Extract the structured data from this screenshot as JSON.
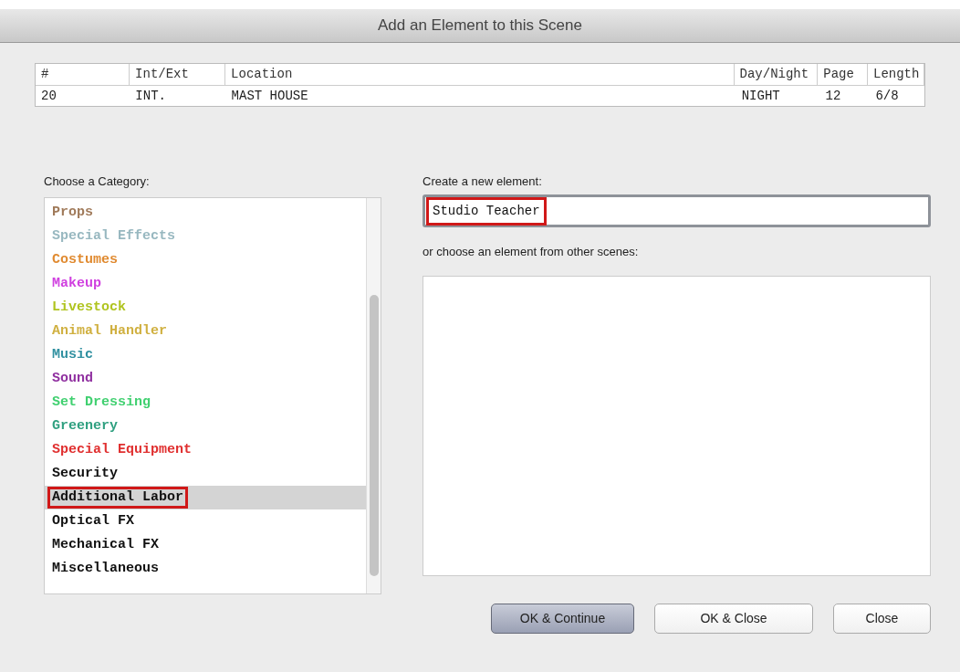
{
  "window": {
    "title": "Add an Element to this Scene"
  },
  "scene_table": {
    "columns": [
      "#",
      "Int/Ext",
      "Location",
      "Day/Night",
      "Page",
      "Length"
    ],
    "rows": [
      [
        "20",
        "INT.",
        "MAST HOUSE",
        "NIGHT",
        "12",
        "6/8"
      ]
    ]
  },
  "category_label": "Choose a Category:",
  "categories": [
    {
      "label": "Props",
      "color": "#a07a5a",
      "selected": false,
      "annotated": false
    },
    {
      "label": "Special Effects",
      "color": "#98b8c0",
      "selected": false,
      "annotated": false
    },
    {
      "label": "Costumes",
      "color": "#e08a30",
      "selected": false,
      "annotated": false
    },
    {
      "label": "Makeup",
      "color": "#d040e0",
      "selected": false,
      "annotated": false
    },
    {
      "label": "Livestock",
      "color": "#b0c420",
      "selected": false,
      "annotated": false
    },
    {
      "label": "Animal Handler",
      "color": "#d0b040",
      "selected": false,
      "annotated": false
    },
    {
      "label": "Music",
      "color": "#3090a0",
      "selected": false,
      "annotated": false
    },
    {
      "label": "Sound",
      "color": "#9030a0",
      "selected": false,
      "annotated": false
    },
    {
      "label": "Set Dressing",
      "color": "#40d070",
      "selected": false,
      "annotated": false
    },
    {
      "label": "Greenery",
      "color": "#30a080",
      "selected": false,
      "annotated": false
    },
    {
      "label": "Special Equipment",
      "color": "#e03030",
      "selected": false,
      "annotated": false
    },
    {
      "label": "Security",
      "color": "#111111",
      "selected": false,
      "annotated": false
    },
    {
      "label": "Additional Labor",
      "color": "#111111",
      "selected": true,
      "annotated": true
    },
    {
      "label": "Optical FX",
      "color": "#111111",
      "selected": false,
      "annotated": false
    },
    {
      "label": "Mechanical FX",
      "color": "#111111",
      "selected": false,
      "annotated": false
    },
    {
      "label": "Miscellaneous",
      "color": "#111111",
      "selected": false,
      "annotated": false
    }
  ],
  "new_element": {
    "label": "Create a new element:",
    "value": "Studio Teacher",
    "annotated": true
  },
  "other_label": "or choose an element from other scenes:",
  "buttons": [
    {
      "label": "OK & Continue",
      "default": true
    },
    {
      "label": "OK & Close",
      "default": false
    },
    {
      "label": "Close",
      "default": false
    }
  ]
}
